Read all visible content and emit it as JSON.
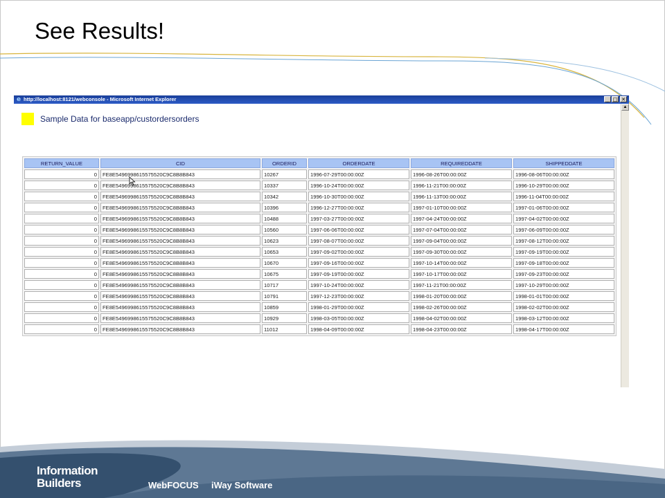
{
  "slide": {
    "title": "See Results!"
  },
  "browser": {
    "window_title": "http://localhost:8121/webconsole - Microsoft Internet Explorer",
    "buttons": {
      "minimize": "_",
      "maximize": "□",
      "close": "✕"
    },
    "scroll_up": "▲"
  },
  "page": {
    "heading": "Sample Data for baseapp/custordersorders",
    "marker_color": "#ffff00"
  },
  "table": {
    "headers": [
      "RETURN_VALUE",
      "CID",
      "ORDERID",
      "ORDERDATE",
      "REQUIREDDATE",
      "SHIPPEDDATE"
    ],
    "rows": [
      [
        "0",
        "FE8E5496998615575520C9C8B8B843",
        "10267",
        "1996-07-29T00:00:00Z",
        "1996-08-26T00:00:00Z",
        "1996-08-06T00:00:00Z"
      ],
      [
        "0",
        "FE8E5496998615575520C9C8B8B843",
        "10337",
        "1996-10-24T00:00:00Z",
        "1996-11-21T00:00:00Z",
        "1996-10-29T00:00:00Z"
      ],
      [
        "0",
        "FE8E5496998615575520C9C8B8B843",
        "10342",
        "1996-10-30T00:00:00Z",
        "1996-11-13T00:00:00Z",
        "1996-11-04T00:00:00Z"
      ],
      [
        "0",
        "FE8E5496998615575520C9C8B8B843",
        "10396",
        "1996-12-27T00:00:00Z",
        "1997-01-10T00:00:00Z",
        "1997-01-06T00:00:00Z"
      ],
      [
        "0",
        "FE8E5496998615575520C9C8B8B843",
        "10488",
        "1997-03-27T00:00:00Z",
        "1997-04-24T00:00:00Z",
        "1997-04-02T00:00:00Z"
      ],
      [
        "0",
        "FE8E5496998615575520C9C8B8B843",
        "10560",
        "1997-06-06T00:00:00Z",
        "1997-07-04T00:00:00Z",
        "1997-06-09T00:00:00Z"
      ],
      [
        "0",
        "FE8E5496998615575520C9C8B8B843",
        "10623",
        "1997-08-07T00:00:00Z",
        "1997-09-04T00:00:00Z",
        "1997-08-12T00:00:00Z"
      ],
      [
        "0",
        "FE8E5496998615575520C9C8B8B843",
        "10653",
        "1997-09-02T00:00:00Z",
        "1997-09-30T00:00:00Z",
        "1997-09-19T00:00:00Z"
      ],
      [
        "0",
        "FE8E5496998615575520C9C8B8B843",
        "10670",
        "1997-09-16T00:00:00Z",
        "1997-10-14T00:00:00Z",
        "1997-09-18T00:00:00Z"
      ],
      [
        "0",
        "FE8E5496998615575520C9C8B8B843",
        "10675",
        "1997-09-19T00:00:00Z",
        "1997-10-17T00:00:00Z",
        "1997-09-23T00:00:00Z"
      ],
      [
        "0",
        "FE8E5496998615575520C9C8B8B843",
        "10717",
        "1997-10-24T00:00:00Z",
        "1997-11-21T00:00:00Z",
        "1997-10-29T00:00:00Z"
      ],
      [
        "0",
        "FE8E5496998615575520C9C8B8B843",
        "10791",
        "1997-12-23T00:00:00Z",
        "1998-01-20T00:00:00Z",
        "1998-01-01T00:00:00Z"
      ],
      [
        "0",
        "FE8E5496998615575520C9C8B8B843",
        "10859",
        "1998-01-29T00:00:00Z",
        "1998-02-26T00:00:00Z",
        "1998-02-02T00:00:00Z"
      ],
      [
        "0",
        "FE8E5496998615575520C9C8B8B843",
        "10929",
        "1998-03-05T00:00:00Z",
        "1998-04-02T00:00:00Z",
        "1998-03-12T00:00:00Z"
      ],
      [
        "0",
        "FE8E5496998615575520C9C8B8B843",
        "11012",
        "1998-04-09T00:00:00Z",
        "1998-04-23T00:00:00Z",
        "1998-04-17T00:00:00Z"
      ]
    ]
  },
  "footer": {
    "brand_line1": "Information",
    "brand_line2": "Builders",
    "links": [
      "WebFOCUS",
      "iWay Software"
    ],
    "colors": {
      "dark_band": "#34506e",
      "mid_band": "#5e7894",
      "light_band": "#c4cdd8",
      "accent_gold": "#d8b43c",
      "accent_blue": "#6aa4d4"
    }
  }
}
